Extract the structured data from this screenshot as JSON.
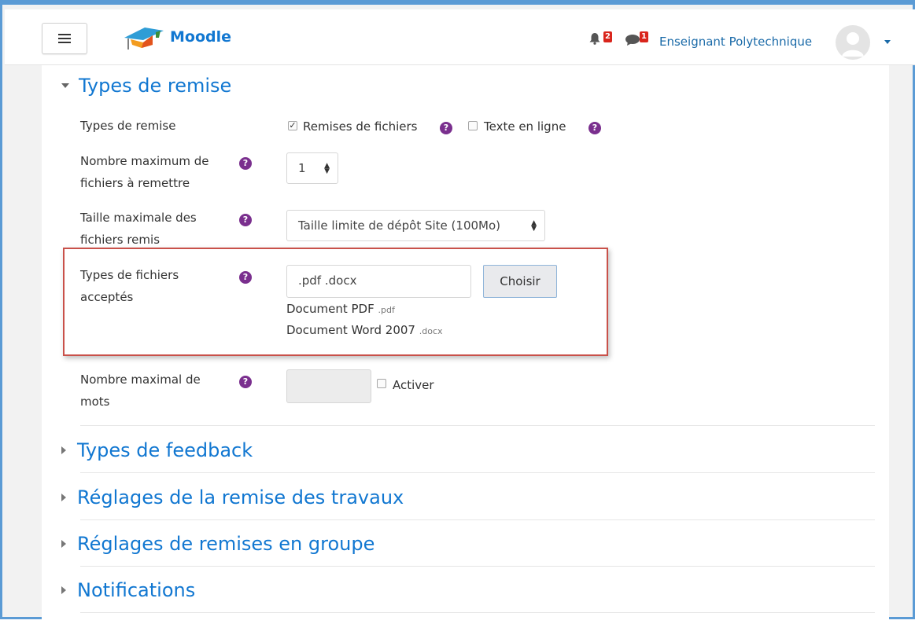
{
  "navbar": {
    "brand": "Moodle",
    "notifications_count": "2",
    "messages_count": "1",
    "user_name": "Enseignant Polytechnique"
  },
  "sections": {
    "submission_types": {
      "title": "Types de remise",
      "rows": {
        "types_label": "Types de remise",
        "file_submissions_label": "Remises de fichiers",
        "file_submissions_checked": true,
        "online_text_label": "Texte en ligne",
        "online_text_checked": false,
        "max_files_label_line1": "Nombre maximum de",
        "max_files_label_line2": "fichiers à remettre",
        "max_files_value": "1",
        "max_size_label_line1": "Taille maximale des",
        "max_size_label_line2": "fichiers remis",
        "max_size_value": "Taille limite de dépôt Site (100Mo)",
        "accepted_types_label_line1": "Types de fichiers",
        "accepted_types_label_line2": "acceptés",
        "accepted_types_value": ".pdf .docx",
        "choose_button": "Choisir",
        "file_types": [
          {
            "name": "Document PDF",
            "ext": ".pdf"
          },
          {
            "name": "Document Word 2007",
            "ext": ".docx"
          }
        ],
        "word_limit_label_line1": "Nombre maximal de",
        "word_limit_label_line2": "mots",
        "word_limit_value": "",
        "enable_label": "Activer"
      }
    },
    "feedback_types": {
      "title": "Types de feedback"
    },
    "submission_settings": {
      "title": "Réglages de la remise des travaux"
    },
    "group_submission_settings": {
      "title": "Réglages de remises en groupe"
    },
    "notifications": {
      "title": "Notifications"
    }
  },
  "colors": {
    "brand_blue": "#1177d1",
    "help_purple": "#7a2f8e",
    "badge_red": "#d9251c",
    "highlight_red": "#c9514a",
    "frame_blue": "#5b9bd5"
  },
  "icons": [
    "menu-icon",
    "moodle-logo-icon",
    "bell-icon",
    "chat-icon",
    "avatar-icon",
    "help-icon",
    "check-icon",
    "select-arrows-icon"
  ]
}
